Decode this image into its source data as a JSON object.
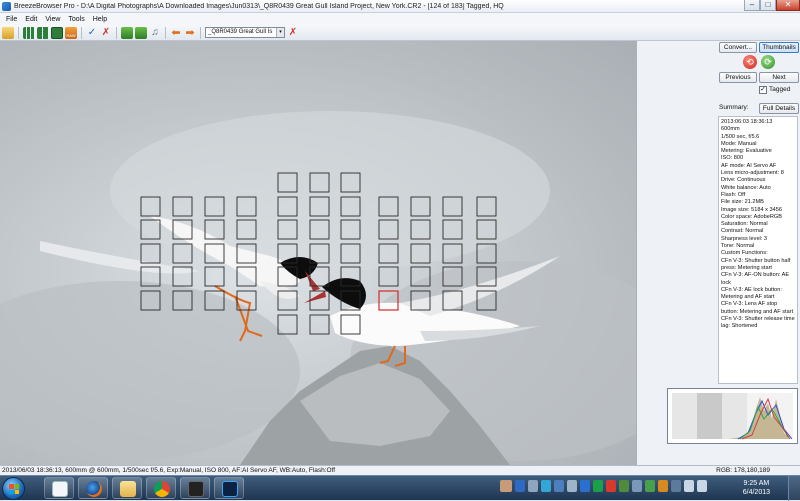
{
  "window": {
    "title": "BreezeBrowser Pro - D:\\A Digital Photographs\\A Downloaded Images\\Jun0313\\_Q8R0439  Great Gull Island Project, New York.CR2 - [124 of 183] Tagged, HQ",
    "minimize": "–",
    "maximize": "□",
    "close": "✕"
  },
  "menu": [
    "File",
    "Edit",
    "View",
    "Tools",
    "Help"
  ],
  "toolbar": {
    "file_select": "_Q8R0439  Great Gull Is",
    "dropdown_glyph": "▾",
    "icons": [
      "open-folder-icon",
      "thumbnails-grid-icon",
      "large-thumbnails-icon",
      "single-image-icon",
      "raw-icon",
      "tag-check-icon",
      "untag-icon",
      "image-left-icon",
      "image-right-icon",
      "music-icon",
      "prev-arrow-icon",
      "next-arrow-icon"
    ],
    "raw_label": "RAW"
  },
  "side": {
    "convert_label": "Convert...",
    "thumbnails_label": "Thumbnails",
    "previous_label": "Previous",
    "next_label": "Next",
    "tagged_label": "Tagged",
    "tagged_checked": true,
    "summary_label": "Summary:",
    "full_details_label": "Full Details",
    "info": [
      "2013:06:03 18:36:13",
      "600mm",
      "1/500 sec, f/5.6",
      "Mode: Manual",
      "Metering: Evaluative",
      "ISO: 800",
      "AF mode: AI Servo AF",
      "Lens micro-adjustment: 8",
      "Drive: Continuous",
      "White balance: Auto",
      "Flash: Off",
      "File size: 21.2MB",
      "Image size: 5184 x 3456",
      "Color space: AdobeRGB",
      "Saturation: Normal",
      "Contrast: Normal",
      "Sharpness level: 3",
      "Tone: Normal",
      "Custom Functions:",
      "CFn V-3: Shutter button half press: Metering start",
      "CFn V-3: AF-ON button: AE lock",
      "CFn V-3: AE lock button: Metering and AF start",
      "CFn V-3: Lens AF stop button: Metering and AF start",
      "CFn V-3: Shutter release time lag: Shortened"
    ]
  },
  "status": {
    "text": "2013/06/03 18:36:13, 600mm @ 600mm, 1/500sec f/5.6, Exp:Manual, ISO 800, AF:AI Servo AF, WB:Auto, Flash:Off",
    "rgb": "RGB: 178,180,189"
  },
  "taskbar": {
    "time": "9:25 AM",
    "date": "6/4/2013",
    "apps": [
      "file-icon",
      "firefox-icon",
      "folder-icon",
      "chrome-icon",
      "camera-icon",
      "photoshop-icon"
    ]
  },
  "colors": {
    "af_point_active": "#d42a2a",
    "af_point": "#2a2a2a"
  }
}
